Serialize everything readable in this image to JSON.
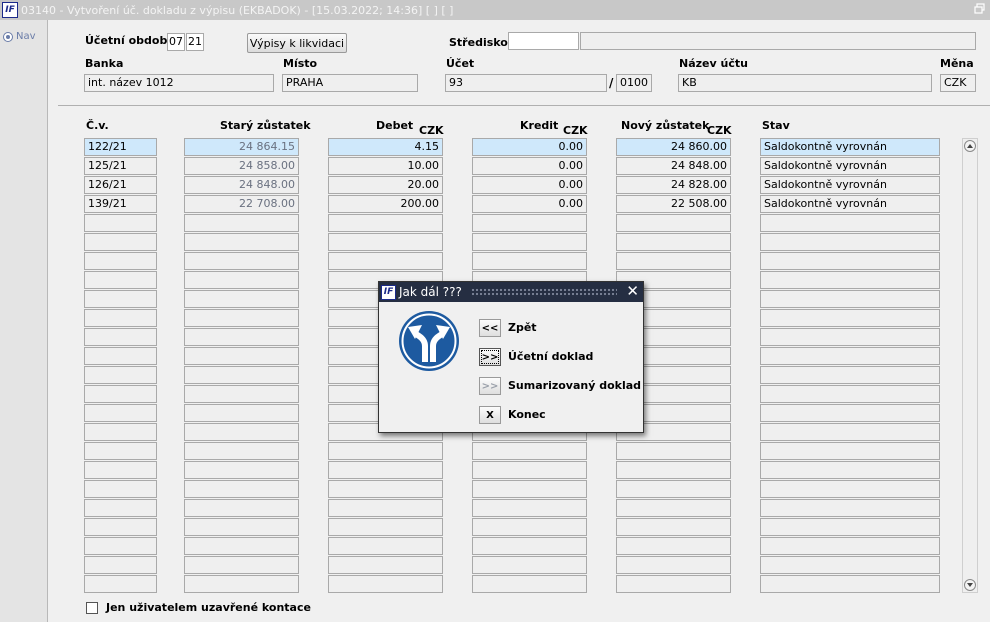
{
  "window": {
    "title": "03140 - Vytvoření úč. dokladu z výpisu (EKBADOK) - [15.03.2022; 14:36]  [ ]  [ ]",
    "logo": "IF"
  },
  "nav": {
    "label": "Nav"
  },
  "form": {
    "period_label": "Účetní období",
    "period_month": "07",
    "period_year": "21",
    "liquidation_button": "Výpisy k likvidaci",
    "center_label": "Středisko",
    "center_code": "",
    "center_name": "",
    "bank_label": "Banka",
    "bank_value": "int. název 1012",
    "place_label": "Místo",
    "place_value": "PRAHA",
    "account_label": "Účet",
    "account_value": "93",
    "account_sep": "/",
    "account_code": "0100",
    "account_name_label": "Název účtu",
    "account_name_value": "KB",
    "currency_label": "Měna",
    "currency_value": "CZK"
  },
  "table": {
    "headers": {
      "cv": "Č.v.",
      "old": "Starý zůstatek",
      "debet": "Debet",
      "debet_cur": "CZK",
      "kredit": "Kredit",
      "kredit_cur": "CZK",
      "new": "Nový zůstatek",
      "new_cur": "CZK",
      "stav": "Stav"
    },
    "rows": [
      {
        "cv": "122/21",
        "old": "24 864.15",
        "debet": "4.15",
        "kredit": "0.00",
        "new": "24 860.00",
        "stav": "Saldokontně vyrovnán"
      },
      {
        "cv": "125/21",
        "old": "24 858.00",
        "debet": "10.00",
        "kredit": "0.00",
        "new": "24 848.00",
        "stav": "Saldokontně vyrovnán"
      },
      {
        "cv": "126/21",
        "old": "24 848.00",
        "debet": "20.00",
        "kredit": "0.00",
        "new": "24 828.00",
        "stav": "Saldokontně vyrovnán"
      },
      {
        "cv": "139/21",
        "old": "22 708.00",
        "debet": "200.00",
        "kredit": "0.00",
        "new": "22 508.00",
        "stav": "Saldokontně vyrovnán"
      }
    ],
    "total_rows": 24
  },
  "footer": {
    "checkbox_label": "Jen uživatelem uzavřené kontace"
  },
  "dialog": {
    "title": "Jak dál ???",
    "options": [
      {
        "symbol": "<<",
        "label": "Zpět",
        "state": "normal"
      },
      {
        "symbol": ">>",
        "label": "Účetní doklad",
        "state": "focused"
      },
      {
        "symbol": ">>",
        "label": "Sumarizovaný doklad",
        "state": "disabled"
      },
      {
        "symbol": "X",
        "label": "Konec",
        "state": "normal"
      }
    ],
    "colors": {
      "icon_blue": "#1d5aa0",
      "title_bg": "#252e42"
    }
  }
}
